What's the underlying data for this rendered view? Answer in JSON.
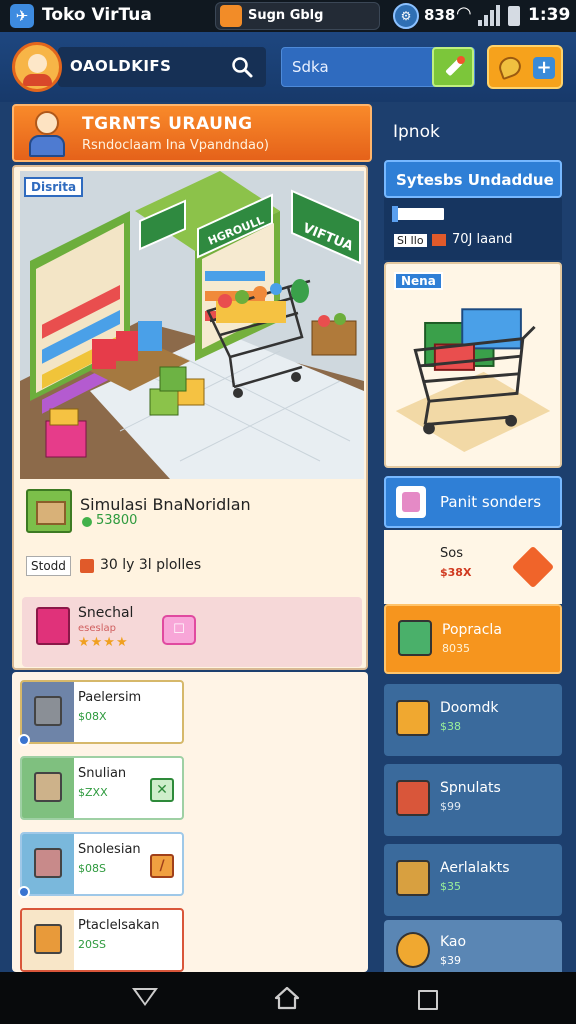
{
  "status_bar": {
    "app_title": "Toko VirTua",
    "app_icon": "app-icon",
    "notification": "Sugn Gblg",
    "count": "838",
    "time": "1:39"
  },
  "header": {
    "store_name": "OAOLDKIFS",
    "search_placeholder": "Sdka",
    "accent": "#2f6bbf"
  },
  "promo": {
    "title": "TGRNTS URAUNG",
    "subtitle": "Rsndoclaam Ina Vpandndao)"
  },
  "scene": {
    "tag": "Disrita",
    "sign_left": "HGROULL",
    "sign_right": "VIFTUA"
  },
  "simulation": {
    "title": "Simulasi BnaNoridlan",
    "price": "53800",
    "stock_label": "Stodd",
    "stock_text": "30 ly 3l plolles"
  },
  "special": {
    "title": "Snechal",
    "subtitle": "eseslap",
    "stars": "★★★★"
  },
  "list_items": [
    {
      "name": "Paelersim",
      "price": "$08X",
      "thumb_color": "#6e84a8",
      "badge": ""
    },
    {
      "name": "Snulian",
      "price": "$ZXX",
      "thumb_color": "#7fc07f",
      "badge": "✕"
    },
    {
      "name": "Snolesian",
      "price": "$08S",
      "thumb_color": "#7ab8dc",
      "badge": "/"
    },
    {
      "name": "Ptaclelsakan",
      "price": "20SS",
      "thumb_color": "#f0a040",
      "badge": ""
    }
  ],
  "right": {
    "heading": "Ipnok",
    "banner": "Sytesbs Undaddue",
    "tag": "Sl Ilo",
    "info": "70J laand",
    "product_tag": "Nena",
    "category": "Panit sonders",
    "deal": {
      "title": "Sos",
      "price": "$38X"
    },
    "items": [
      {
        "name": "Popracla",
        "price": "8035"
      },
      {
        "name": "Doomdk",
        "price": "$38"
      },
      {
        "name": "Spnulats",
        "price": "$99"
      },
      {
        "name": "Aerlalakts",
        "price": "$35"
      },
      {
        "name": "Kao",
        "price": "$39"
      }
    ]
  },
  "colors": {
    "background": "#1d3f6e",
    "orange": "#f98a2a",
    "green": "#7cc63a",
    "card": "#fff3e0"
  }
}
